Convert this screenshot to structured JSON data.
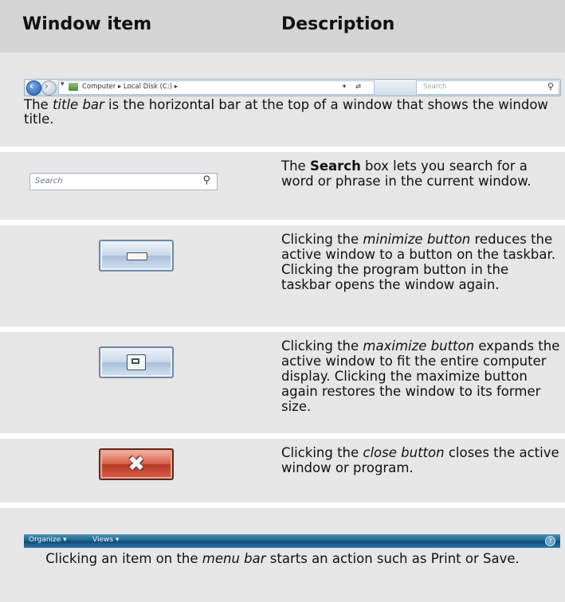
{
  "header": {
    "col1": "Window item",
    "col2": "Description"
  },
  "title_bar": {
    "address": "Computer  ▸  Local Disk (C:)  ▸",
    "search_placeholder": "Search",
    "caption_pre": "The ",
    "caption_term": "title bar",
    "caption_post": " is the horizontal bar at the top of a window that shows the window title."
  },
  "search_box": {
    "placeholder": "Search",
    "desc_pre": "The ",
    "desc_term": "Search",
    "desc_post": " box lets you search for a word or phrase in the current window."
  },
  "minimize": {
    "desc_pre": "Clicking the ",
    "desc_term": "minimize button",
    "desc_post": " reduces the active window to a button on the taskbar. Clicking the program button in the taskbar opens the window again."
  },
  "maximize": {
    "desc_pre": "Clicking the ",
    "desc_term": "maximize button",
    "desc_post": " expands the active window to fit the entire computer display. Clicking the maximize button again restores the window to its former size."
  },
  "close": {
    "desc_pre": "Clicking the ",
    "desc_term": "close button",
    "desc_post": " closes the active window or program."
  },
  "menu_bar": {
    "item_organize": "Organize ▾",
    "item_views": "Views ▾",
    "caption_pre": "Clicking an item on the ",
    "caption_term": "menu bar",
    "caption_post": " starts an action such as Print or Save."
  }
}
